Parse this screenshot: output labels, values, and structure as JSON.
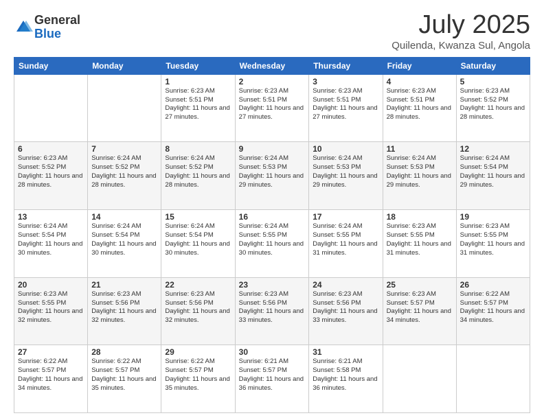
{
  "logo": {
    "general": "General",
    "blue": "Blue"
  },
  "header": {
    "month": "July 2025",
    "location": "Quilenda, Kwanza Sul, Angola"
  },
  "weekdays": [
    "Sunday",
    "Monday",
    "Tuesday",
    "Wednesday",
    "Thursday",
    "Friday",
    "Saturday"
  ],
  "weeks": [
    [
      {
        "day": "",
        "sunrise": "",
        "sunset": "",
        "daylight": ""
      },
      {
        "day": "",
        "sunrise": "",
        "sunset": "",
        "daylight": ""
      },
      {
        "day": "1",
        "sunrise": "Sunrise: 6:23 AM",
        "sunset": "Sunset: 5:51 PM",
        "daylight": "Daylight: 11 hours and 27 minutes."
      },
      {
        "day": "2",
        "sunrise": "Sunrise: 6:23 AM",
        "sunset": "Sunset: 5:51 PM",
        "daylight": "Daylight: 11 hours and 27 minutes."
      },
      {
        "day": "3",
        "sunrise": "Sunrise: 6:23 AM",
        "sunset": "Sunset: 5:51 PM",
        "daylight": "Daylight: 11 hours and 27 minutes."
      },
      {
        "day": "4",
        "sunrise": "Sunrise: 6:23 AM",
        "sunset": "Sunset: 5:51 PM",
        "daylight": "Daylight: 11 hours and 28 minutes."
      },
      {
        "day": "5",
        "sunrise": "Sunrise: 6:23 AM",
        "sunset": "Sunset: 5:52 PM",
        "daylight": "Daylight: 11 hours and 28 minutes."
      }
    ],
    [
      {
        "day": "6",
        "sunrise": "Sunrise: 6:23 AM",
        "sunset": "Sunset: 5:52 PM",
        "daylight": "Daylight: 11 hours and 28 minutes."
      },
      {
        "day": "7",
        "sunrise": "Sunrise: 6:24 AM",
        "sunset": "Sunset: 5:52 PM",
        "daylight": "Daylight: 11 hours and 28 minutes."
      },
      {
        "day": "8",
        "sunrise": "Sunrise: 6:24 AM",
        "sunset": "Sunset: 5:52 PM",
        "daylight": "Daylight: 11 hours and 28 minutes."
      },
      {
        "day": "9",
        "sunrise": "Sunrise: 6:24 AM",
        "sunset": "Sunset: 5:53 PM",
        "daylight": "Daylight: 11 hours and 29 minutes."
      },
      {
        "day": "10",
        "sunrise": "Sunrise: 6:24 AM",
        "sunset": "Sunset: 5:53 PM",
        "daylight": "Daylight: 11 hours and 29 minutes."
      },
      {
        "day": "11",
        "sunrise": "Sunrise: 6:24 AM",
        "sunset": "Sunset: 5:53 PM",
        "daylight": "Daylight: 11 hours and 29 minutes."
      },
      {
        "day": "12",
        "sunrise": "Sunrise: 6:24 AM",
        "sunset": "Sunset: 5:54 PM",
        "daylight": "Daylight: 11 hours and 29 minutes."
      }
    ],
    [
      {
        "day": "13",
        "sunrise": "Sunrise: 6:24 AM",
        "sunset": "Sunset: 5:54 PM",
        "daylight": "Daylight: 11 hours and 30 minutes."
      },
      {
        "day": "14",
        "sunrise": "Sunrise: 6:24 AM",
        "sunset": "Sunset: 5:54 PM",
        "daylight": "Daylight: 11 hours and 30 minutes."
      },
      {
        "day": "15",
        "sunrise": "Sunrise: 6:24 AM",
        "sunset": "Sunset: 5:54 PM",
        "daylight": "Daylight: 11 hours and 30 minutes."
      },
      {
        "day": "16",
        "sunrise": "Sunrise: 6:24 AM",
        "sunset": "Sunset: 5:55 PM",
        "daylight": "Daylight: 11 hours and 30 minutes."
      },
      {
        "day": "17",
        "sunrise": "Sunrise: 6:24 AM",
        "sunset": "Sunset: 5:55 PM",
        "daylight": "Daylight: 11 hours and 31 minutes."
      },
      {
        "day": "18",
        "sunrise": "Sunrise: 6:23 AM",
        "sunset": "Sunset: 5:55 PM",
        "daylight": "Daylight: 11 hours and 31 minutes."
      },
      {
        "day": "19",
        "sunrise": "Sunrise: 6:23 AM",
        "sunset": "Sunset: 5:55 PM",
        "daylight": "Daylight: 11 hours and 31 minutes."
      }
    ],
    [
      {
        "day": "20",
        "sunrise": "Sunrise: 6:23 AM",
        "sunset": "Sunset: 5:55 PM",
        "daylight": "Daylight: 11 hours and 32 minutes."
      },
      {
        "day": "21",
        "sunrise": "Sunrise: 6:23 AM",
        "sunset": "Sunset: 5:56 PM",
        "daylight": "Daylight: 11 hours and 32 minutes."
      },
      {
        "day": "22",
        "sunrise": "Sunrise: 6:23 AM",
        "sunset": "Sunset: 5:56 PM",
        "daylight": "Daylight: 11 hours and 32 minutes."
      },
      {
        "day": "23",
        "sunrise": "Sunrise: 6:23 AM",
        "sunset": "Sunset: 5:56 PM",
        "daylight": "Daylight: 11 hours and 33 minutes."
      },
      {
        "day": "24",
        "sunrise": "Sunrise: 6:23 AM",
        "sunset": "Sunset: 5:56 PM",
        "daylight": "Daylight: 11 hours and 33 minutes."
      },
      {
        "day": "25",
        "sunrise": "Sunrise: 6:23 AM",
        "sunset": "Sunset: 5:57 PM",
        "daylight": "Daylight: 11 hours and 34 minutes."
      },
      {
        "day": "26",
        "sunrise": "Sunrise: 6:22 AM",
        "sunset": "Sunset: 5:57 PM",
        "daylight": "Daylight: 11 hours and 34 minutes."
      }
    ],
    [
      {
        "day": "27",
        "sunrise": "Sunrise: 6:22 AM",
        "sunset": "Sunset: 5:57 PM",
        "daylight": "Daylight: 11 hours and 34 minutes."
      },
      {
        "day": "28",
        "sunrise": "Sunrise: 6:22 AM",
        "sunset": "Sunset: 5:57 PM",
        "daylight": "Daylight: 11 hours and 35 minutes."
      },
      {
        "day": "29",
        "sunrise": "Sunrise: 6:22 AM",
        "sunset": "Sunset: 5:57 PM",
        "daylight": "Daylight: 11 hours and 35 minutes."
      },
      {
        "day": "30",
        "sunrise": "Sunrise: 6:21 AM",
        "sunset": "Sunset: 5:57 PM",
        "daylight": "Daylight: 11 hours and 36 minutes."
      },
      {
        "day": "31",
        "sunrise": "Sunrise: 6:21 AM",
        "sunset": "Sunset: 5:58 PM",
        "daylight": "Daylight: 11 hours and 36 minutes."
      },
      {
        "day": "",
        "sunrise": "",
        "sunset": "",
        "daylight": ""
      },
      {
        "day": "",
        "sunrise": "",
        "sunset": "",
        "daylight": ""
      }
    ]
  ]
}
